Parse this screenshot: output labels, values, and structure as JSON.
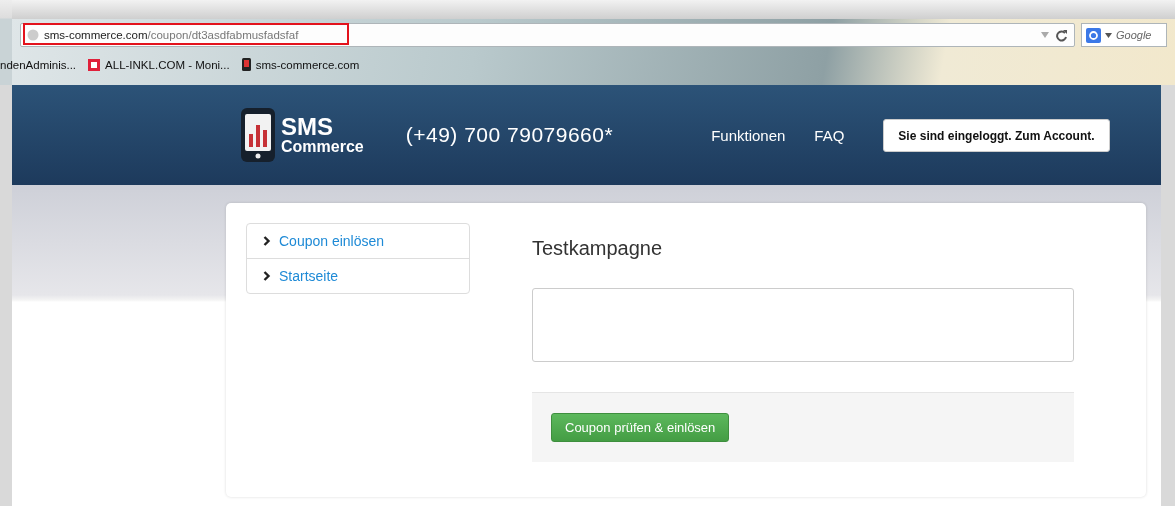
{
  "browser": {
    "url_host": "sms-commerce.com",
    "url_path": "/coupon/dt3asdfabmusfadsfaf",
    "search_engine": "Google",
    "bookmarks": [
      {
        "label": "ndenAdminis...",
        "kind": "plain"
      },
      {
        "label": "ALL-INKL.COM - Moni...",
        "kind": "square"
      },
      {
        "label": "sms-commerce.com",
        "kind": "phone"
      }
    ]
  },
  "header": {
    "logo_top": "SMS",
    "logo_bottom": "Commerce",
    "phone": "(+49) 700 79079660*",
    "nav": [
      "Funktionen",
      "FAQ"
    ],
    "account_button": "Sie sind eingeloggt. Zum Account."
  },
  "sidebar": {
    "items": [
      {
        "label": "Coupon einlösen"
      },
      {
        "label": "Startseite"
      }
    ]
  },
  "content": {
    "title": "Testkampagne",
    "submit_button": "Coupon prüfen & einlösen"
  }
}
